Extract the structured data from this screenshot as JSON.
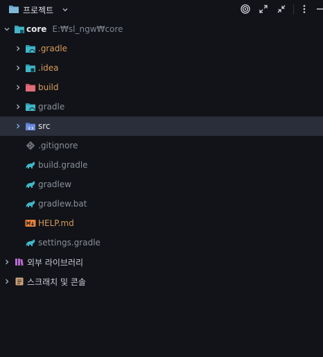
{
  "toolbar": {
    "title": "프로젝트",
    "icons": [
      "folder-icon",
      "chevron-down-icon",
      "target-icon",
      "expand-icon",
      "collapse-icon",
      "more-icon",
      "minimize-icon"
    ]
  },
  "tree": {
    "root": {
      "name": "core",
      "path": "E:₩sl_ngw₩core"
    },
    "items": [
      {
        "name": ".gradle",
        "icon": "folder-gradle-icon"
      },
      {
        "name": ".idea",
        "icon": "folder-idea-icon"
      },
      {
        "name": "build",
        "icon": "folder-build-icon"
      },
      {
        "name": "gradle",
        "icon": "folder-gradle-icon"
      },
      {
        "name": "src",
        "icon": "folder-src-icon"
      },
      {
        "name": ".gitignore",
        "icon": "git-icon"
      },
      {
        "name": "build.gradle",
        "icon": "gradle-elephant-icon"
      },
      {
        "name": "gradlew",
        "icon": "gradle-elephant-icon"
      },
      {
        "name": "gradlew.bat",
        "icon": "gradle-elephant-icon"
      },
      {
        "name": "HELP.md",
        "icon": "markdown-icon"
      },
      {
        "name": "settings.gradle",
        "icon": "gradle-elephant-icon"
      }
    ],
    "external_libraries": "외부 라이브러리",
    "scratches": "스크래치 및 콘솔"
  },
  "colors": {
    "background": "#111318",
    "selection": "#2a2d3a",
    "excluded_orange": "#d99a5a",
    "muted": "#8a8f99",
    "teal": "#3fb8c9"
  }
}
